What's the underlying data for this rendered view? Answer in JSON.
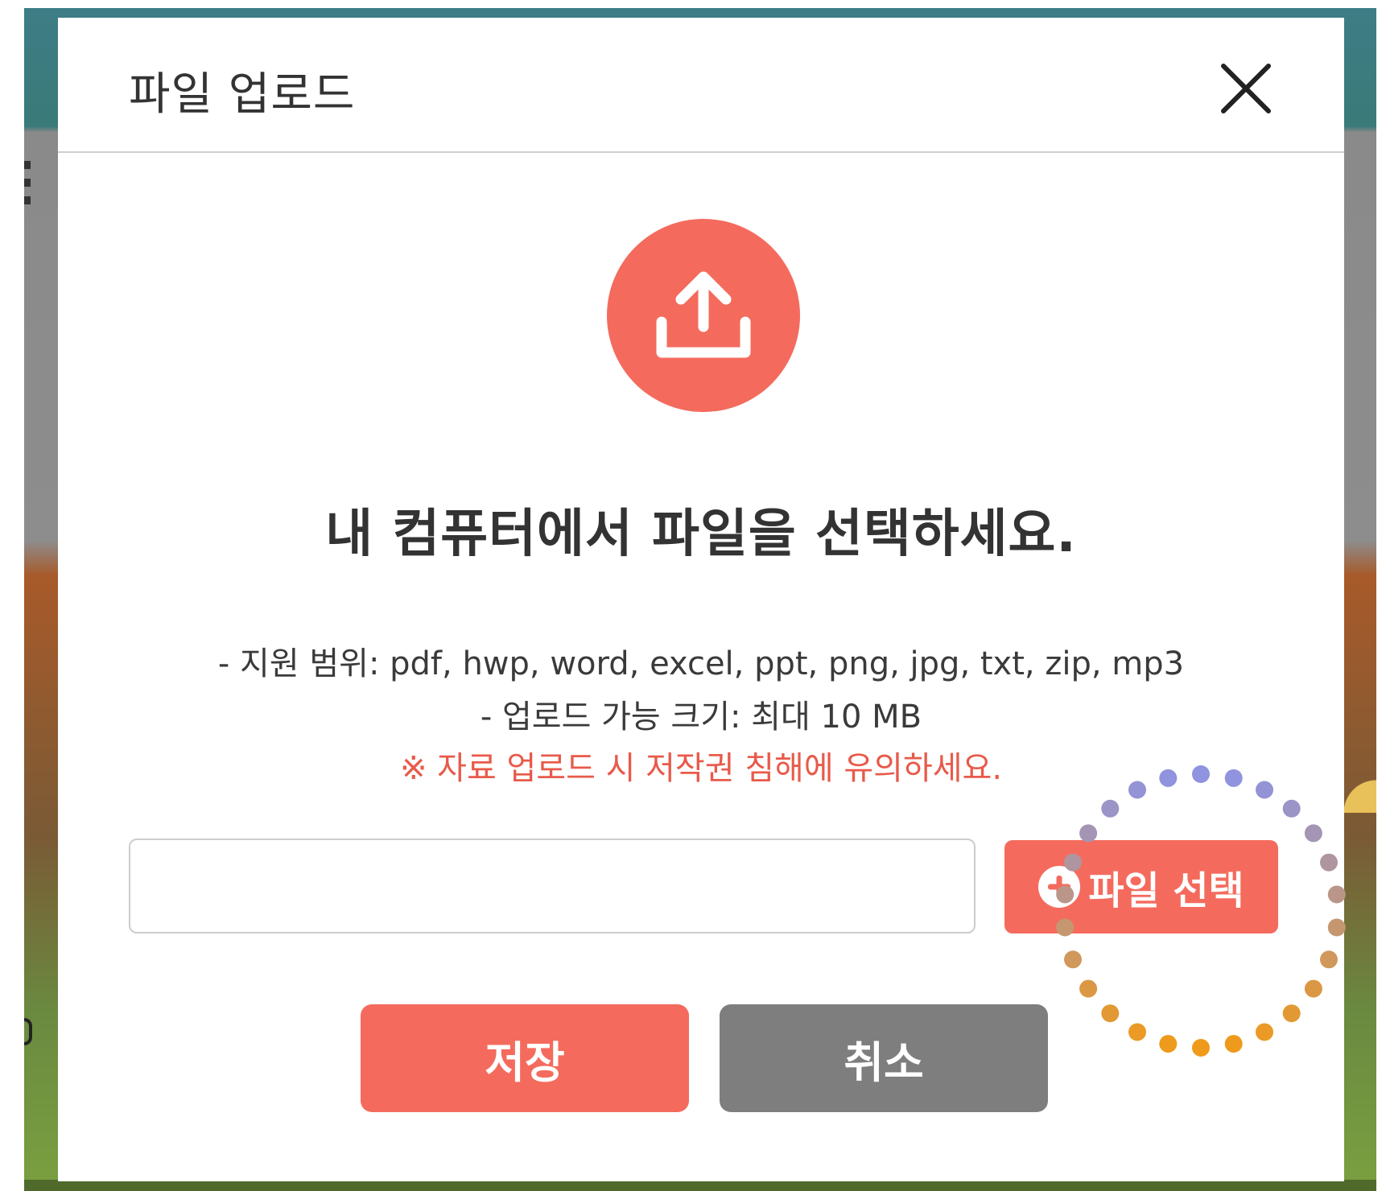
{
  "dialog": {
    "title": "파일 업로드",
    "close_icon": "close-icon",
    "upload_icon": "upload-icon"
  },
  "content": {
    "heading": "내 컴퓨터에서 파일을 선택하세요.",
    "formats": "- 지원 범위: pdf, hwp, word, excel, ppt, png, jpg, txt, zip, mp3",
    "size_limit": "- 업로드 가능 크기: 최대 10 MB",
    "warning": "※ 자료 업로드 시 저작권 침해에 유의하세요."
  },
  "file_input": {
    "value": "",
    "placeholder": ""
  },
  "select_button": {
    "label": "파일 선택",
    "icon": "plus-circle-icon"
  },
  "actions": {
    "save_label": "저장",
    "cancel_label": "취소"
  },
  "colors": {
    "accent": "#f46b5d",
    "cancel": "#7e7e7e",
    "warning_text": "#e85a4a",
    "ring_top": "#8f93e0",
    "ring_bottom": "#ef9a1a"
  }
}
